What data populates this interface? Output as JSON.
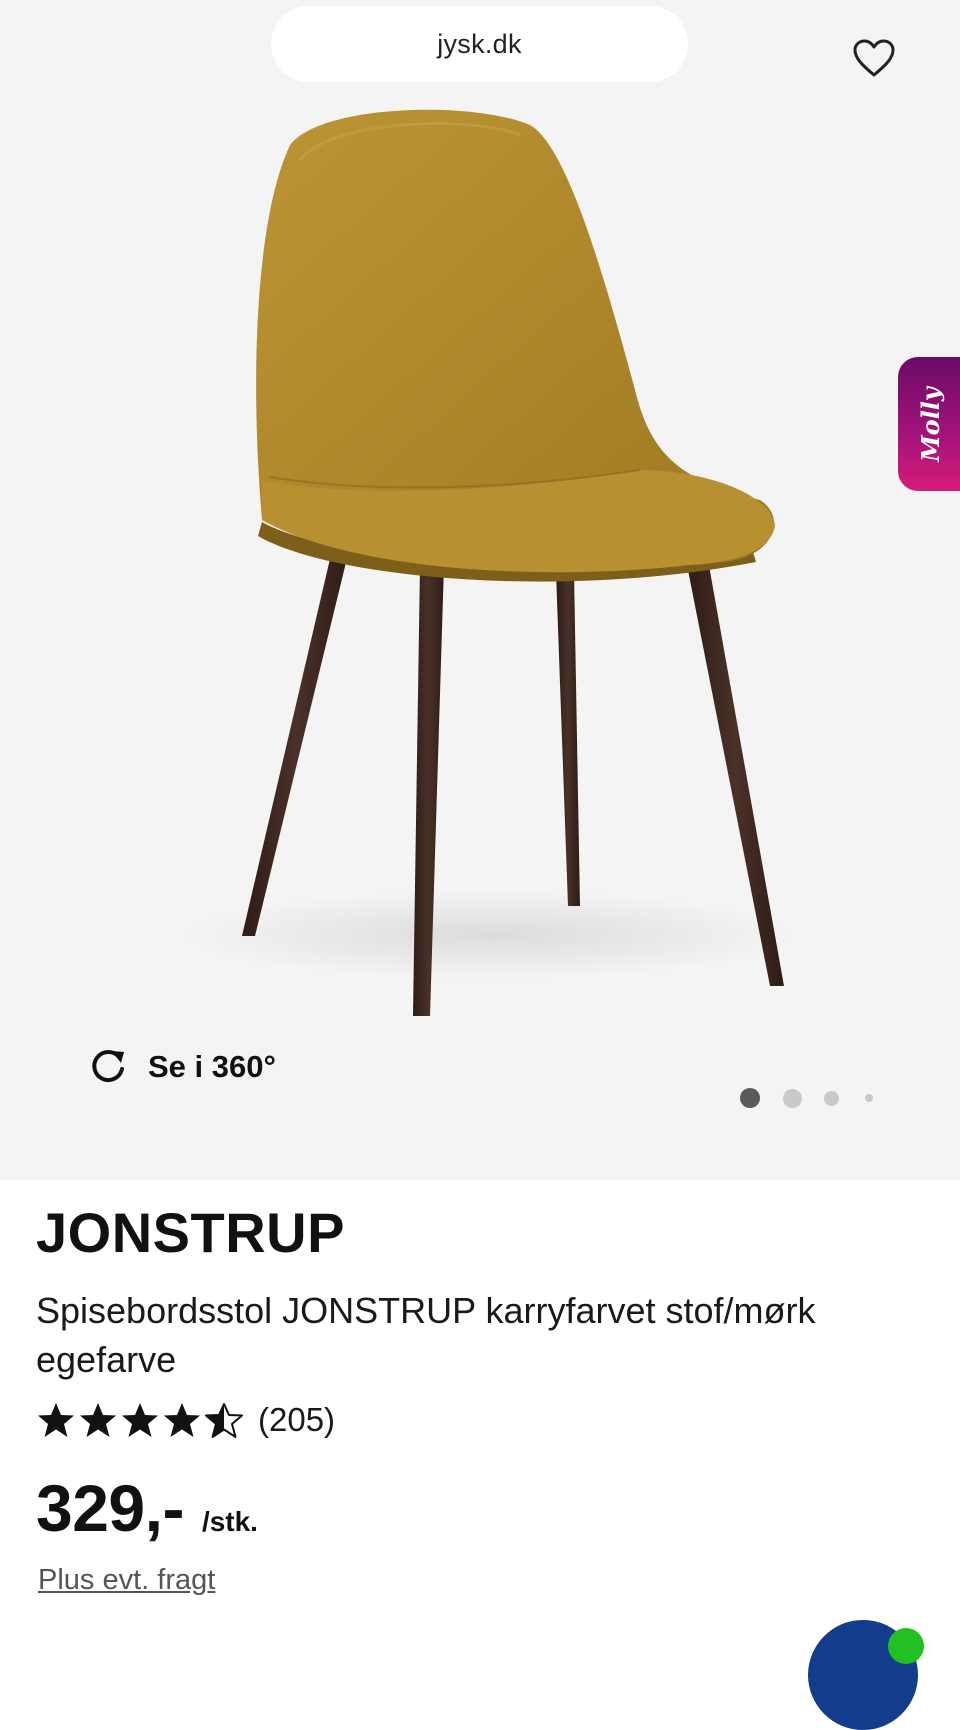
{
  "browser": {
    "url": "jysk.dk"
  },
  "gallery": {
    "view360_label": "Se i 360°",
    "slide_count": 4,
    "active_slide": 1,
    "side_tab_label": "Molly",
    "seat_color": "#b08a2e",
    "leg_color": "#3b2620"
  },
  "product": {
    "brand": "JONSTRUP",
    "description": "Spisebordsstol JONSTRUP karryfarvet stof/mørk egefarve",
    "rating": {
      "value": 4.5,
      "max": 5,
      "count": "(205)"
    },
    "price": "329,-",
    "unit": "/stk.",
    "shipping_note": "Plus evt. fragt"
  },
  "icons": {
    "favorite": "heart-outline-icon",
    "rotate": "rotate-360-icon",
    "star": "star-icon"
  }
}
